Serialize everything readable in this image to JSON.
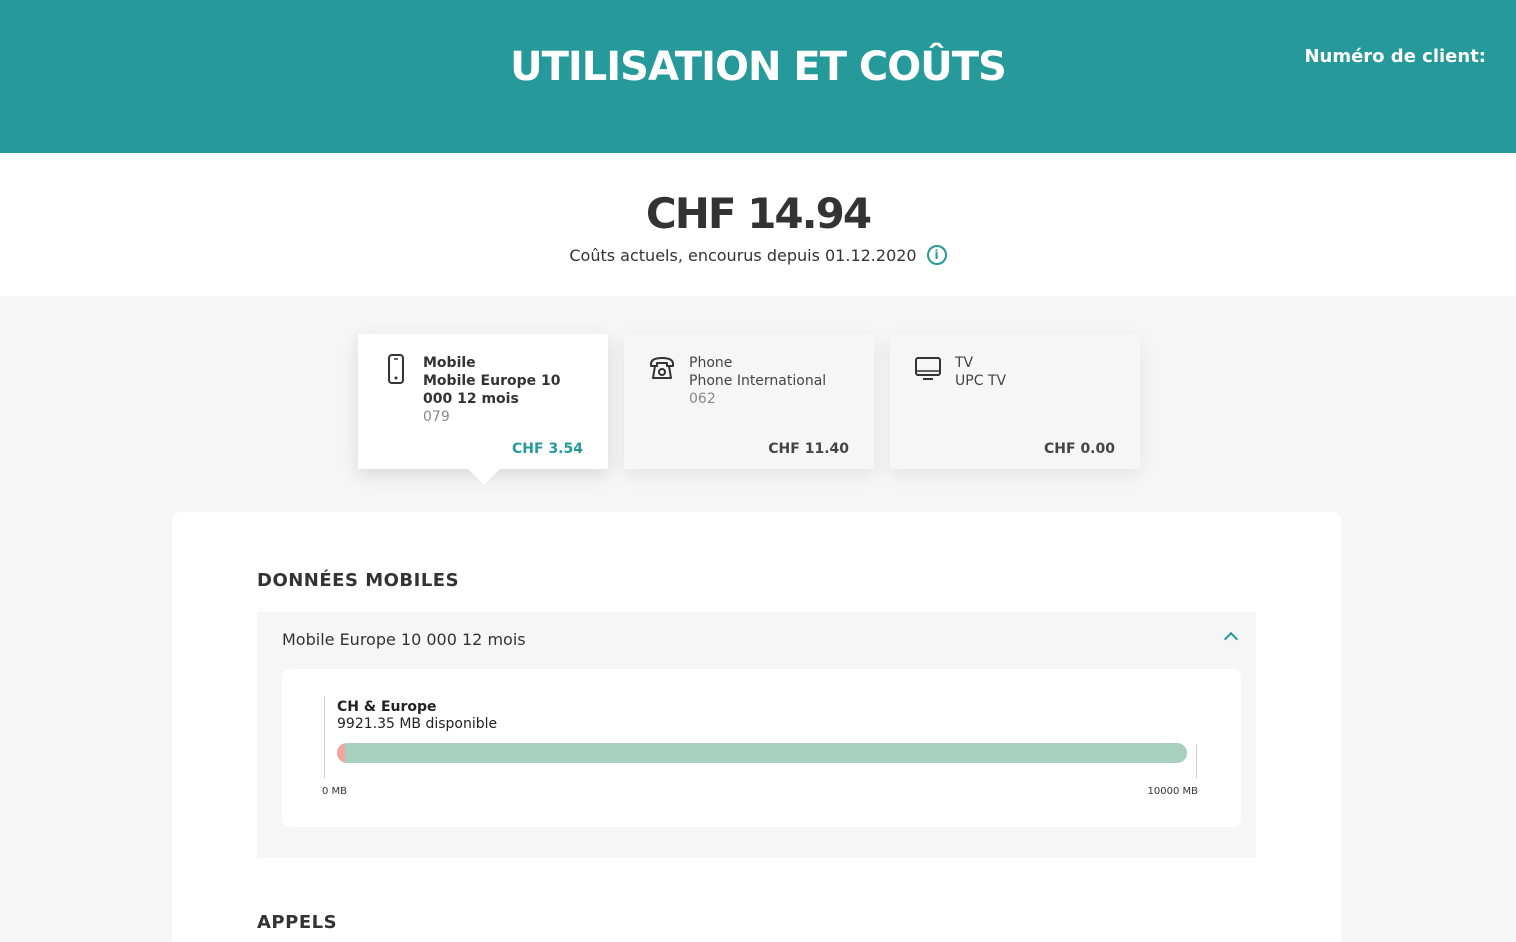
{
  "header": {
    "title": "UTILISATION ET COÛTS",
    "client_label": "Numéro de client:"
  },
  "summary": {
    "total": "CHF 14.94",
    "subtitle": "Coûts actuels, encourus depuis 01.12.2020",
    "info_icon": "info-icon"
  },
  "cards": [
    {
      "icon": "mobile-phone-icon",
      "category": "Mobile",
      "plan": "Mobile Europe 10 000 12 mois",
      "number": "079",
      "price": "CHF 3.54",
      "active": true
    },
    {
      "icon": "landline-phone-icon",
      "category": "Phone",
      "plan": "Phone International",
      "number": "062",
      "price": "CHF 11.40",
      "active": false
    },
    {
      "icon": "tv-icon",
      "category": "TV",
      "plan": "UPC TV",
      "number": "",
      "price": "CHF 0.00",
      "active": false
    }
  ],
  "sections": {
    "mobile_data_title": "DONNÉES MOBILES",
    "calls_title": "APPELS"
  },
  "mobile_data": {
    "plan_name": "Mobile Europe 10 000 12 mois",
    "usage_title": "CH & Europe",
    "usage_available": "9921.35 MB disponible",
    "used_fraction": 0.0079,
    "axis_min": "0 MB",
    "axis_max": "10000 MB"
  },
  "colors": {
    "accent": "#26999a",
    "bar_remaining": "#a8d0c0",
    "bar_used": "#f3a6a0"
  }
}
